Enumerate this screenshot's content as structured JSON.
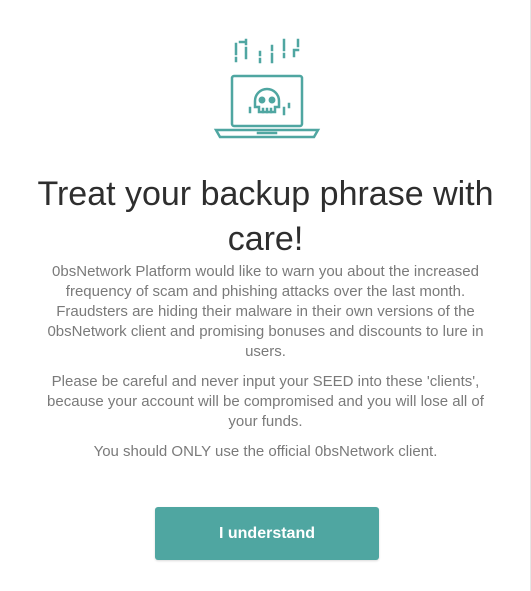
{
  "dialog": {
    "illustration_icon": "laptop-skull-icon",
    "title": "Treat your backup phrase with care!",
    "paragraphs": [
      "0bsNetwork Platform would like to warn you about the increased frequency of scam and phishing attacks over the last month. Fraudsters are hiding their malware in their own versions of the 0bsNetwork client and promising bonuses and discounts to lure in users.",
      "Please be careful and never input your SEED into these 'clients', because your account will be compromised and you will lose all of your funds.",
      "You should ONLY use the official 0bsNetwork client."
    ],
    "button_label": "I understand"
  },
  "colors": {
    "accent": "#4fa6a1",
    "title_text": "#2e2e2e",
    "body_text": "#7a7a7a"
  }
}
